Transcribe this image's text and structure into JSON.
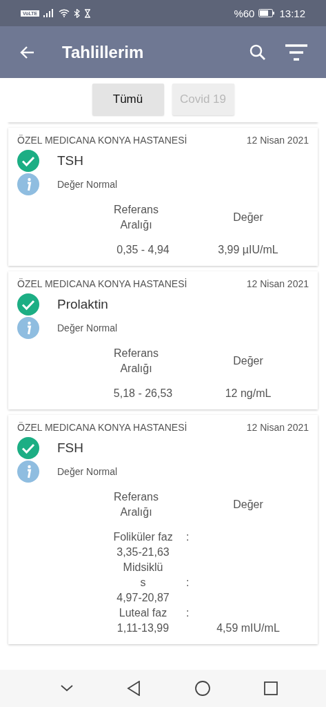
{
  "status_bar": {
    "left_badge": "VoLTE",
    "battery_text": "%60",
    "time": "13:12"
  },
  "app_bar": {
    "title": "Tahlillerim"
  },
  "tabs": [
    {
      "label": "Tümü",
      "selected": true
    },
    {
      "label": "Covid 19",
      "selected": false
    }
  ],
  "results": [
    {
      "hospital": "ÖZEL MEDICANA KONYA HASTANESİ",
      "date": "12 Nisan 2021",
      "test": "TSH",
      "status": "Değer Normal",
      "ok": true,
      "range_header": [
        "Referans",
        "Aralığı"
      ],
      "value_header": "Değer",
      "range_lines": [
        {
          "text": "0,35 - 4,94"
        }
      ],
      "value": "3,99 µIU/mL"
    },
    {
      "hospital": "ÖZEL MEDICANA KONYA HASTANESİ",
      "date": "12 Nisan 2021",
      "test": "Prolaktin",
      "status": "Değer Normal",
      "ok": true,
      "range_header": [
        "Referans",
        "Aralığı"
      ],
      "value_header": "Değer",
      "range_lines": [
        {
          "text": "5,18 - 26,53"
        }
      ],
      "value": "12 ng/mL"
    },
    {
      "hospital": "ÖZEL MEDICANA KONYA HASTANESİ",
      "date": "12 Nisan 2021",
      "test": "FSH",
      "status": "Değer Normal",
      "ok": true,
      "range_header": [
        "Referans",
        "Aralığı"
      ],
      "value_header": "Değer",
      "range_lines": [
        {
          "text": "Foliküler faz",
          "suffix": ":"
        },
        {
          "text": "3,35-21,63"
        },
        {
          "text": "Midsiklü"
        },
        {
          "text": "s",
          "suffix": ":"
        },
        {
          "text": "4,97-20,87"
        },
        {
          "text": "Luteal faz",
          "suffix": ":"
        },
        {
          "text": "1,11-13,99"
        }
      ],
      "value": "4,59 mIU/mL"
    }
  ]
}
